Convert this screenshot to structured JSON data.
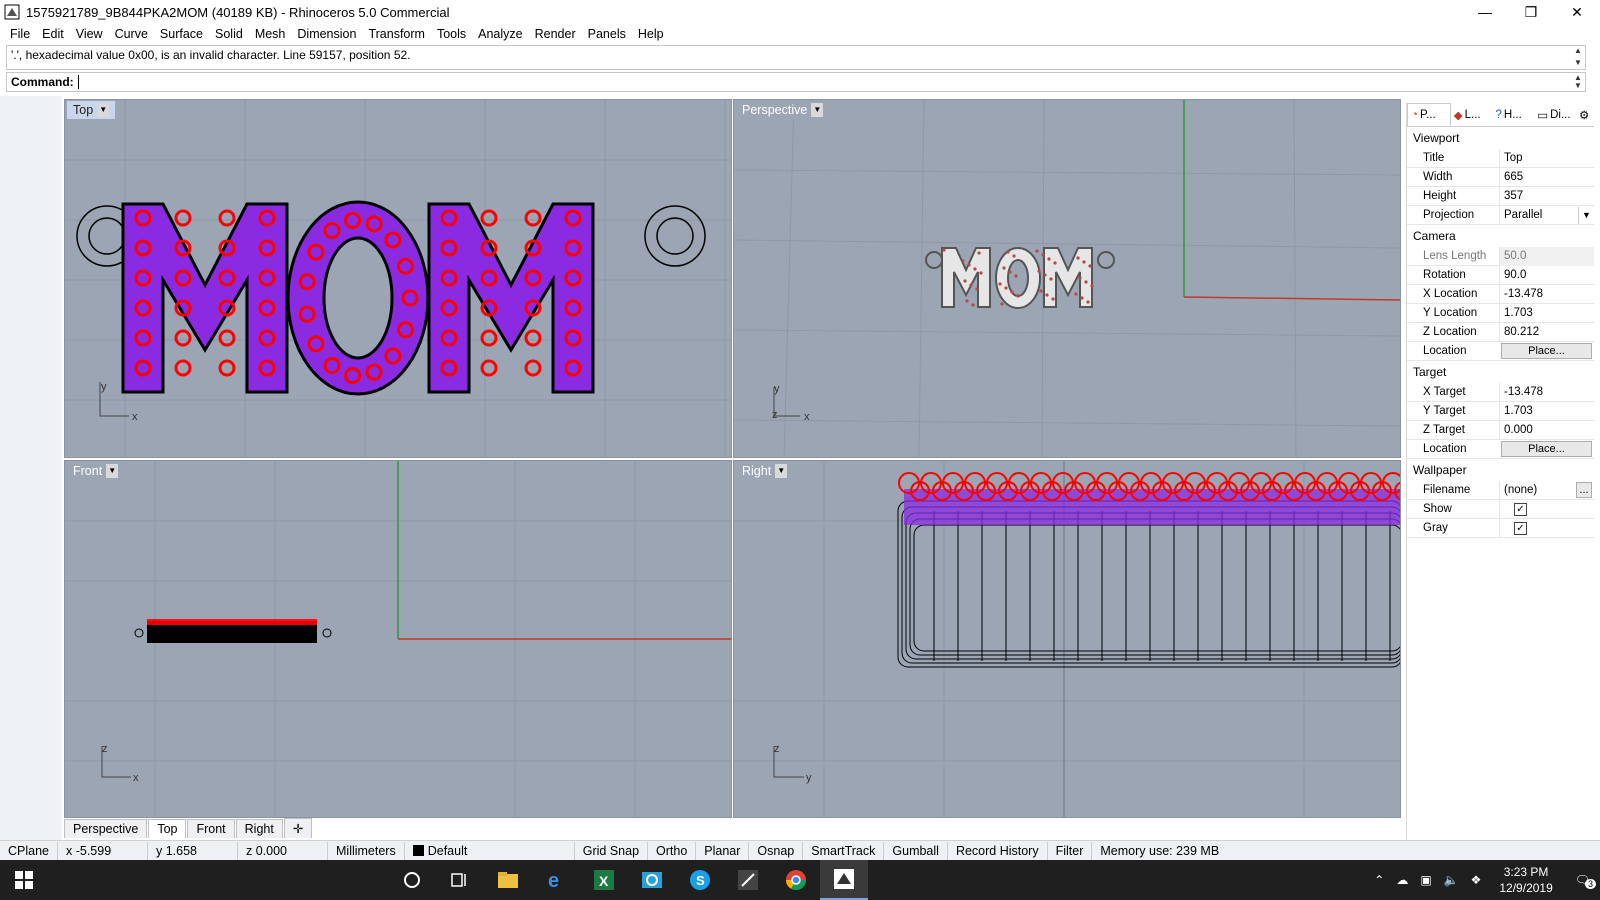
{
  "window": {
    "title": "1575921789_9B844PKA2MOM (40189 KB) - Rhinoceros 5.0 Commercial",
    "minimize": "—",
    "restore": "❐",
    "close": "✕"
  },
  "menu": [
    "File",
    "Edit",
    "View",
    "Curve",
    "Surface",
    "Solid",
    "Mesh",
    "Dimension",
    "Transform",
    "Tools",
    "Analyze",
    "Render",
    "Panels",
    "Help"
  ],
  "command": {
    "history": "'.', hexadecimal value 0x00, is an invalid character. Line 59157, position 52.",
    "label": "Command:"
  },
  "viewports": {
    "top": {
      "label": "Top",
      "active": true
    },
    "perspective": {
      "label": "Perspective",
      "model_text": "MOM"
    },
    "front": {
      "label": "Front"
    },
    "right": {
      "label": "Right"
    }
  },
  "viewport_tabs": [
    "Perspective",
    "Top",
    "Front",
    "Right"
  ],
  "viewport_tabs_active": "Top",
  "panel": {
    "tabs": [
      {
        "label": "P...",
        "icon": "properties-icon",
        "active": true
      },
      {
        "label": "L...",
        "icon": "layers-icon",
        "active": false
      },
      {
        "label": "H...",
        "icon": "help-icon",
        "active": false
      },
      {
        "label": "Di...",
        "icon": "display-icon",
        "active": false
      }
    ],
    "sections": {
      "viewport": "Viewport",
      "camera": "Camera",
      "target": "Target",
      "wallpaper": "Wallpaper"
    },
    "viewport": {
      "title_k": "Title",
      "title_v": "Top",
      "width_k": "Width",
      "width_v": "665",
      "height_k": "Height",
      "height_v": "357",
      "projection_k": "Projection",
      "projection_v": "Parallel"
    },
    "camera": {
      "lens_k": "Lens Length",
      "lens_v": "50.0",
      "rotation_k": "Rotation",
      "rotation_v": "90.0",
      "xloc_k": "X Location",
      "xloc_v": "-13.478",
      "yloc_k": "Y Location",
      "yloc_v": "1.703",
      "zloc_k": "Z Location",
      "zloc_v": "80.212",
      "loc_k": "Location",
      "loc_btn": "Place..."
    },
    "target": {
      "x_k": "X Target",
      "x_v": "-13.478",
      "y_k": "Y Target",
      "y_v": "1.703",
      "z_k": "Z Target",
      "z_v": "0.000",
      "loc_k": "Location",
      "loc_btn": "Place..."
    },
    "wallpaper": {
      "file_k": "Filename",
      "file_v": "(none)",
      "file_btn": "...",
      "show_k": "Show",
      "show_v": true,
      "gray_k": "Gray",
      "gray_v": true
    }
  },
  "status": {
    "cplane": "CPlane",
    "x": "x -5.599",
    "y": "y 1.658",
    "z": "z 0.000",
    "units": "Millimeters",
    "layer": "Default",
    "gridsnap": "Grid Snap",
    "ortho": "Ortho",
    "planar": "Planar",
    "osnap": "Osnap",
    "smarttrack": "SmartTrack",
    "gumball": "Gumball",
    "record": "Record History",
    "filter": "Filter",
    "memory": "Memory use: 239 MB"
  },
  "taskbar": {
    "time": "3:23 PM",
    "date": "12/9/2019",
    "notifications": "3"
  },
  "colors": {
    "viewport_bg": "#9ba5b3",
    "gem_red": "#ff0000",
    "gem_purple": "#8a2be2",
    "axis_x": "#c0392b",
    "axis_y": "#2e9a3a"
  }
}
